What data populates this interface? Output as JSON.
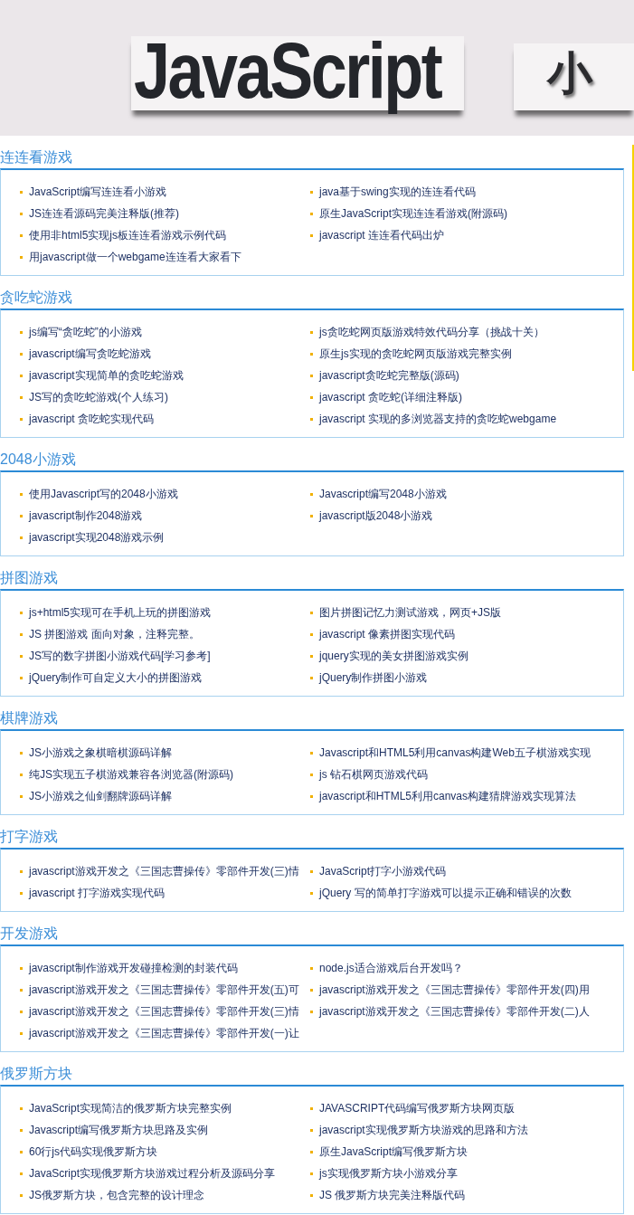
{
  "banner": {
    "title": "JavaScript",
    "subtitle": "小"
  },
  "sections": [
    {
      "heading": "连连看游戏",
      "links": [
        "JavaScript编写连连看小游戏",
        "java基于swing实现的连连看代码",
        "JS连连看源码完美注释版(推荐)",
        "原生JavaScript实现连连看游戏(附源码)",
        "使用非html5实现js板连连看游戏示例代码",
        "javascript 连连看代码出炉",
        "用javascript做一个webgame连连看大家看下"
      ]
    },
    {
      "heading": "贪吃蛇游戏",
      "links": [
        "js编写“贪吃蛇”的小游戏",
        "js贪吃蛇网页版游戏特效代码分享（挑战十关）",
        "javascript编写贪吃蛇游戏",
        "原生js实现的贪吃蛇网页版游戏完整实例",
        "javascript实现简单的贪吃蛇游戏",
        "javascript贪吃蛇完整版(源码)",
        "JS写的贪吃蛇游戏(个人练习)",
        "javascript 贪吃蛇(详细注释版)",
        "javascript 贪吃蛇实现代码",
        "javascript 实现的多浏览器支持的贪吃蛇webgame"
      ]
    },
    {
      "heading": "2048小游戏",
      "links": [
        "使用Javascript写的2048小游戏",
        "Javascript编写2048小游戏",
        "javascript制作2048游戏",
        "javascript版2048小游戏",
        "javascript实现2048游戏示例"
      ]
    },
    {
      "heading": "拼图游戏",
      "links": [
        "js+html5实现可在手机上玩的拼图游戏",
        "图片拼图记忆力测试游戏，网页+JS版",
        "JS 拼图游戏 面向对象，注释完整。",
        "javascript 像素拼图实现代码",
        "JS写的数字拼图小游戏代码[学习参考]",
        "jquery实现的美女拼图游戏实例",
        "jQuery制作可自定义大小的拼图游戏",
        "jQuery制作拼图小游戏"
      ]
    },
    {
      "heading": "棋牌游戏",
      "links": [
        "JS小游戏之象棋暗棋源码详解",
        "Javascript和HTML5利用canvas构建Web五子棋游戏实现",
        "纯JS实现五子棋游戏兼容各浏览器(附源码)",
        "js 钻石棋网页游戏代码",
        "JS小游戏之仙剑翻牌源码详解",
        "javascript和HTML5利用canvas构建猜牌游戏实现算法"
      ]
    },
    {
      "heading": "打字游戏",
      "links": [
        "javascript游戏开发之《三国志曹操传》零部件开发(三)情",
        "JavaScript打字小游戏代码",
        "javascript 打字游戏实现代码",
        "jQuery 写的简单打字游戏可以提示正确和错误的次数"
      ]
    },
    {
      "heading": "开发游戏",
      "links": [
        "javascript制作游戏开发碰撞检测的封装代码",
        "node.js适合游戏后台开发吗？",
        "javascript游戏开发之《三国志曹操传》零部件开发(五)可",
        "javascript游戏开发之《三国志曹操传》零部件开发(四)用",
        "javascript游戏开发之《三国志曹操传》零部件开发(三)情",
        "javascript游戏开发之《三国志曹操传》零部件开发(二)人",
        "javascript游戏开发之《三国志曹操传》零部件开发(一)让"
      ]
    },
    {
      "heading": "俄罗斯方块",
      "links": [
        "JavaScript实现简洁的俄罗斯方块完整实例",
        "JAVASCRIPT代码编写俄罗斯方块网页版",
        "Javascript编写俄罗斯方块思路及实例",
        "javascript实现俄罗斯方块游戏的思路和方法",
        "60行js代码实现俄罗斯方块",
        "原生JavaScript编写俄罗斯方块",
        "JavaScript实现俄罗斯方块游戏过程分析及源码分享",
        "js实现俄罗斯方块小游戏分享",
        "JS俄罗斯方块，包含完整的设计理念",
        "JS 俄罗斯方块完美注释版代码"
      ]
    }
  ]
}
